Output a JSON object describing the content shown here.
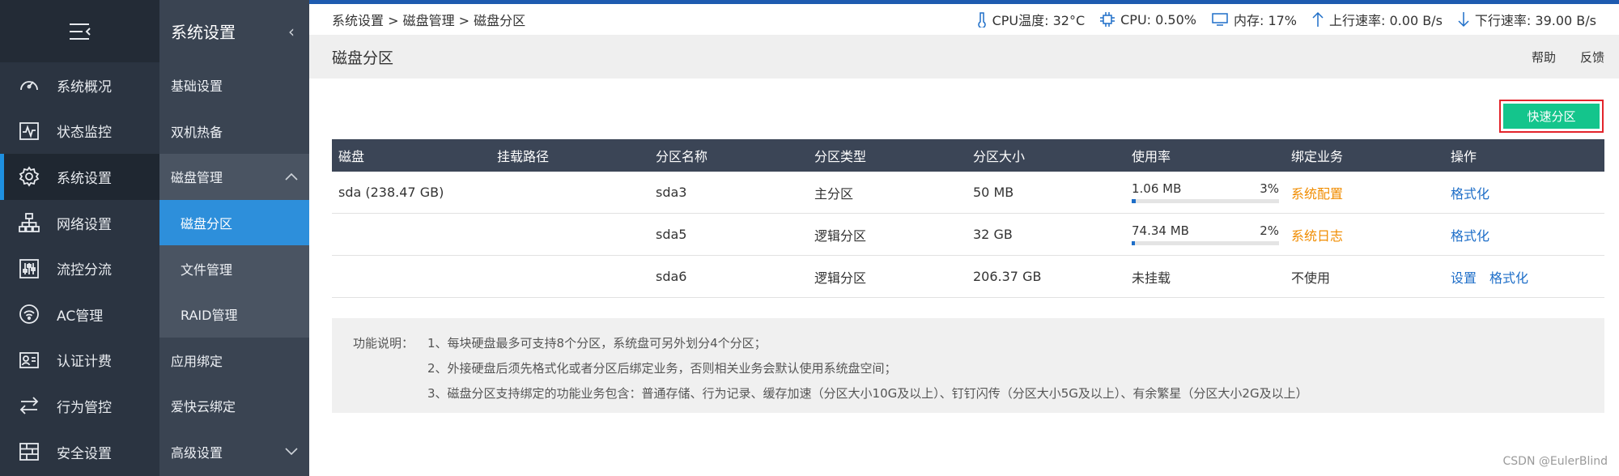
{
  "nav_primary": {
    "items": [
      {
        "label": "系统概况",
        "icon": "gauge-icon"
      },
      {
        "label": "状态监控",
        "icon": "pulse-icon"
      },
      {
        "label": "系统设置",
        "icon": "gear-icon",
        "active": true
      },
      {
        "label": "网络设置",
        "icon": "network-icon"
      },
      {
        "label": "流控分流",
        "icon": "sliders-icon"
      },
      {
        "label": "AC管理",
        "icon": "wifi-icon"
      },
      {
        "label": "认证计费",
        "icon": "id-card-icon"
      },
      {
        "label": "行为管控",
        "icon": "arrows-icon"
      },
      {
        "label": "安全设置",
        "icon": "firewall-icon"
      }
    ]
  },
  "nav_secondary": {
    "title": "系统设置",
    "items": {
      "basic": "基础设置",
      "ha": "双机热备",
      "disk": "磁盘管理",
      "disk_partition": "磁盘分区",
      "file_manage": "文件管理",
      "raid": "RAID管理",
      "app_bind": "应用绑定",
      "aikuai_cloud": "爱快云绑定",
      "advanced": "高级设置"
    }
  },
  "topbar": {
    "breadcrumb": "系统设置 > 磁盘管理 > 磁盘分区",
    "cpu_temp": "CPU温度: 32°C",
    "cpu": "CPU: 0.50%",
    "memory": "内存: 17%",
    "upload": "上行速率: 0.00 B/s",
    "download": "下行速率: 39.00 B/s"
  },
  "page": {
    "title": "磁盘分区",
    "help": "帮助",
    "feedback": "反馈",
    "quick_partition": "快速分区"
  },
  "table": {
    "headers": [
      "磁盘",
      "挂载路径",
      "分区名称",
      "分区类型",
      "分区大小",
      "使用率",
      "绑定业务",
      "操作"
    ],
    "rows": [
      {
        "disk": "sda (238.47 GB)",
        "mount": "",
        "name": "sda3",
        "type": "主分区",
        "size": "50 MB",
        "used": "1.06 MB",
        "percent": "3%",
        "percent_value": 3,
        "binding": "系统配置",
        "op1": "",
        "op2": "格式化"
      },
      {
        "disk": "",
        "mount": "",
        "name": "sda5",
        "type": "逻辑分区",
        "size": "32 GB",
        "used": "74.34 MB",
        "percent": "2%",
        "percent_value": 2,
        "binding": "系统日志",
        "op1": "",
        "op2": "格式化"
      },
      {
        "disk": "",
        "mount": "",
        "name": "sda6",
        "type": "逻辑分区",
        "size": "206.37 GB",
        "used": "未挂载",
        "percent": "",
        "binding": "不使用",
        "op1": "设置",
        "op2": "格式化"
      }
    ]
  },
  "notes": {
    "label": "功能说明：",
    "lines": [
      "1、每块硬盘最多可支持8个分区，系统盘可另外划分4个分区；",
      "2、外接硬盘后须先格式化或者分区后绑定业务，否则相关业务会默认使用系统盘空间；",
      "3、磁盘分区支持绑定的功能业务包含：普通存储、行为记录、缓存加速（分区大小10G及以上）、钉钉闪传（分区大小5G及以上）、有余繁星（分区大小2G及以上）"
    ]
  },
  "watermark": "CSDN @EulerBlind",
  "colors": {
    "accent": "#1e6ec8",
    "button": "#14c58c",
    "highlight_border": "#e3242b",
    "warning_text": "#f08c00"
  }
}
